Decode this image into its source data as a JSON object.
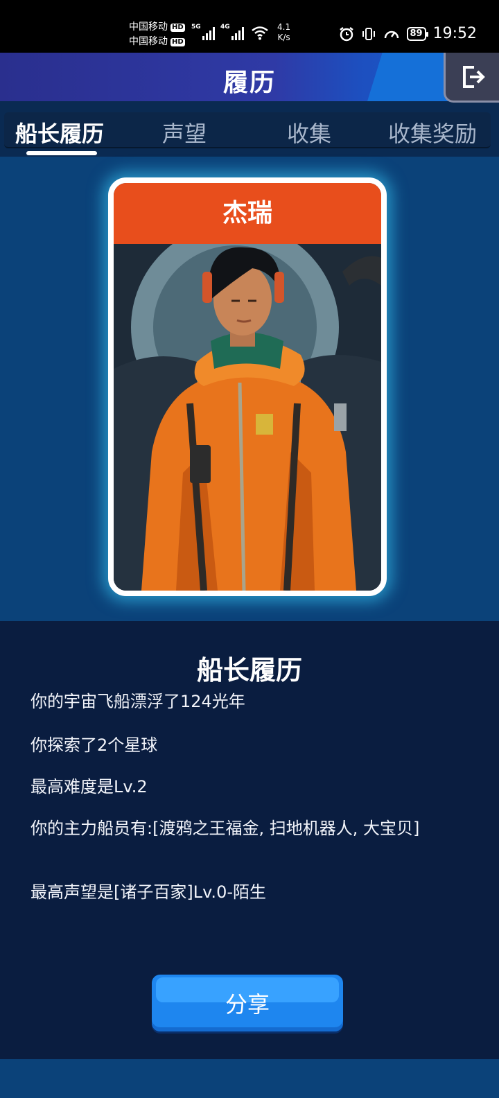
{
  "status_bar": {
    "carrier_1": "中国移动",
    "carrier_2": "中国移动",
    "hd_label": "HD",
    "sig1_tag": "5G",
    "sig2_tag": "4G",
    "net_speed_value": "4.1",
    "net_speed_unit": "K/s",
    "battery": "89",
    "time": "19:52"
  },
  "header": {
    "title": "履历"
  },
  "tabs": [
    {
      "label": "船长履历",
      "active": true
    },
    {
      "label": "声望",
      "active": false
    },
    {
      "label": "收集",
      "active": false
    },
    {
      "label": "收集奖励",
      "active": false
    }
  ],
  "card": {
    "name": "杰瑞"
  },
  "resume": {
    "title": "船长履历",
    "lines": [
      "你的宇宙飞船漂浮了124光年",
      "你探索了2个星球",
      "最高难度是Lv.2",
      "你的主力船员有:[渡鸦之王福金, 扫地机器人, 大宝贝]",
      "最高声望是[诸子百家]Lv.0-陌生"
    ]
  },
  "share_button": {
    "label": "分享"
  },
  "colors": {
    "name_bar": "#e84e1c",
    "card_glow": "#3cd2ff",
    "panel_bg": "#0a1d40",
    "share_button": "#1e86ef"
  }
}
